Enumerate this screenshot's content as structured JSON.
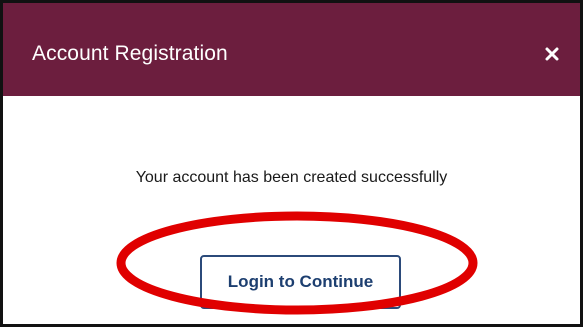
{
  "dialog": {
    "title": "Account Registration",
    "close_icon": "close-icon",
    "message": "Your account has been created successfully",
    "login_button_label": "Login to Continue"
  },
  "colors": {
    "header_background": "#6c1e3e",
    "header_text": "#ffffff",
    "button_text": "#1d3f70",
    "annotation": "#e00000"
  },
  "annotation": {
    "shape": "ellipse",
    "target": "login-button"
  }
}
